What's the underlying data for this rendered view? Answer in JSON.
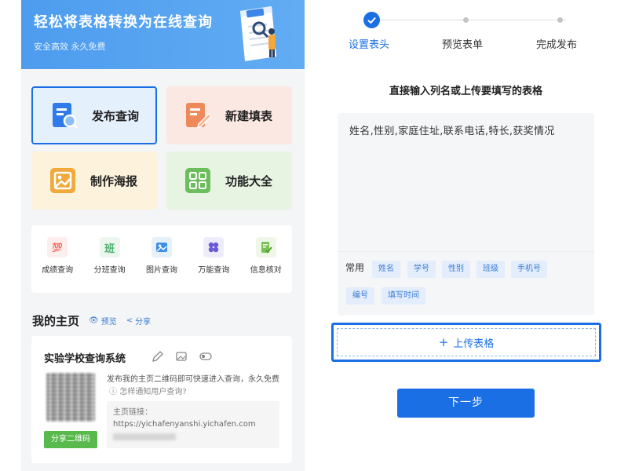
{
  "left": {
    "banner": {
      "title": "轻松将表格转换为在线查询",
      "subtitle": "安全高效 永久免费"
    },
    "cards": [
      {
        "label": "发布查询",
        "icon": "search-document-icon",
        "color": "#2f7bea"
      },
      {
        "label": "新建填表",
        "icon": "edit-document-icon",
        "color": "#ee8a5a"
      },
      {
        "label": "制作海报",
        "icon": "image-icon",
        "color": "#f0a93a"
      },
      {
        "label": "功能大全",
        "icon": "grid-icon",
        "color": "#6cbd5c"
      }
    ],
    "tools": [
      {
        "label": "成绩查询",
        "glyph": "💯",
        "icon": "score-icon"
      },
      {
        "label": "分班查询",
        "glyph": "班",
        "icon": "class-icon"
      },
      {
        "label": "图片查询",
        "glyph": "",
        "icon": "picture-icon"
      },
      {
        "label": "万能查询",
        "glyph": "",
        "icon": "clover-icon"
      },
      {
        "label": "信息核对",
        "glyph": "",
        "icon": "check-document-icon"
      }
    ],
    "home": {
      "title": "我的主页",
      "preview": "预览",
      "share": "分享",
      "site_name": "实验学校查询系统",
      "desc": "发布我的主页二维码即可快速进入查询，永久免费",
      "how": "怎样通知用户查询?",
      "link_label": "主页链接：",
      "link_url": "https://yichafenyanshi.yichafen.com",
      "share_qr": "分享二维码"
    }
  },
  "right": {
    "steps": [
      {
        "label": "设置表头",
        "state": "done"
      },
      {
        "label": "预览表单",
        "state": "todo"
      },
      {
        "label": "完成发布",
        "state": "todo"
      }
    ],
    "heading": "直接输入列名或上传要填写的表格",
    "input_value": "姓名,性别,家庭住址,联系电话,特长,获奖情况",
    "common_label": "常用",
    "tags": [
      "姓名",
      "学号",
      "性别",
      "班级",
      "手机号",
      "编号",
      "填写时间"
    ],
    "upload_label": "上传表格",
    "next_label": "下一步"
  },
  "colors": {
    "primary": "#1a6fe5",
    "banner": "#4d9cee",
    "green": "#58b94d"
  }
}
